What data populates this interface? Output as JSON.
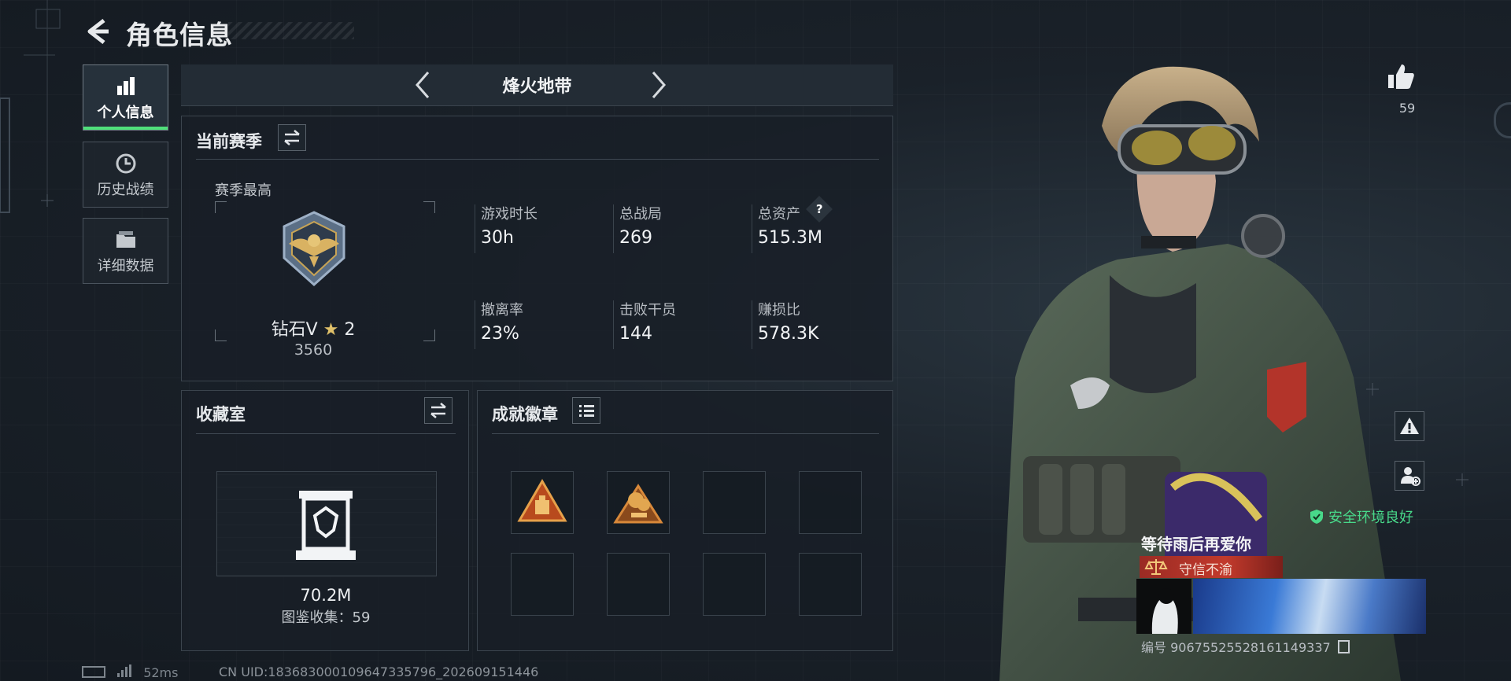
{
  "header": {
    "title": "角色信息"
  },
  "nav": [
    {
      "label": "个人信息",
      "icon": "bar-chart-icon",
      "active": true
    },
    {
      "label": "历史战绩",
      "icon": "history-icon",
      "active": false
    },
    {
      "label": "详细数据",
      "icon": "folder-icon",
      "active": false
    }
  ],
  "mode": {
    "title": "烽火地带"
  },
  "season": {
    "title": "当前赛季",
    "best_label": "赛季最高",
    "rank_name": "钻石V",
    "rank_stars": "2",
    "rank_score": "3560",
    "stats": [
      {
        "label": "游戏时长",
        "value": "30h"
      },
      {
        "label": "总战局",
        "value": "269"
      },
      {
        "label": "总资产",
        "value": "515.3M",
        "help": "?"
      },
      {
        "label": "撤离率",
        "value": "23%"
      },
      {
        "label": "击败干员",
        "value": "144"
      },
      {
        "label": "赚损比",
        "value": "578.3K"
      }
    ]
  },
  "collection": {
    "title": "收藏室",
    "value": "70.2M",
    "catalog_label": "图鉴收集：",
    "catalog_count": "59"
  },
  "badges": {
    "title": "成就徽章",
    "slots_filled": 2,
    "slots_total": 8
  },
  "profile": {
    "likes": "59",
    "safety_status": "安全环境良好",
    "player_name": "等待雨后再爱你",
    "player_title": "守信不渝",
    "id_label": "编号",
    "id_value": "9067552552816114933​7"
  },
  "status": {
    "ping": "52ms",
    "cn_uid": "CN UID:18368300010964733579​6_202609151446"
  },
  "colors": {
    "accent_green": "#4fe07a",
    "title_red": "#c23a2c",
    "panel_bg": "#181f27"
  }
}
